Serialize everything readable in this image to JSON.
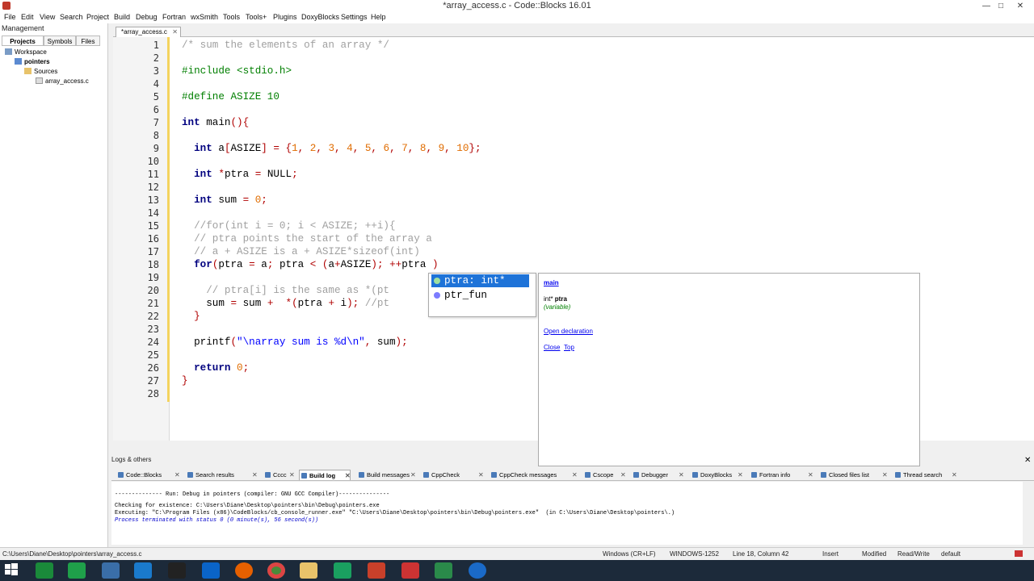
{
  "window": {
    "title": "*array_access.c - Code::Blocks 16.01",
    "minimize": "—",
    "maximize": "□",
    "close": "✕"
  },
  "menu": [
    "File",
    "Edit",
    "View",
    "Search",
    "Project",
    "Build",
    "Debug",
    "Fortran",
    "wxSmith",
    "Tools",
    "Tools+",
    "Plugins",
    "DoxyBlocks",
    "Settings",
    "Help"
  ],
  "management": {
    "title": "Management",
    "tabs": [
      "Projects",
      "Symbols",
      "Files"
    ],
    "tree": [
      "Workspace",
      "pointers",
      "Sources",
      "array_access.c"
    ]
  },
  "editor": {
    "tab_label": "*array_access.c",
    "line_numbers": [
      "1",
      "2",
      "3",
      "4",
      "5",
      "6",
      "7",
      "8",
      "9",
      "10",
      "11",
      "12",
      "13",
      "14",
      "15",
      "16",
      "17",
      "18",
      "19",
      "20",
      "21",
      "22",
      "23",
      "24",
      "25",
      "26",
      "27",
      "28"
    ]
  },
  "autocomplete": {
    "items": [
      "ptra: int*",
      "ptr_fun"
    ],
    "doc": {
      "scope": "main",
      "signature_type": "int*",
      "signature_name": "ptra",
      "kind": "(variable)",
      "open_declaration": "Open declaration",
      "close": "Close",
      "top": "Top"
    }
  },
  "logs": {
    "title": "Logs & others",
    "tabs": [
      "Code::Blocks",
      "Search results",
      "Cccc",
      "Build log",
      "Build messages",
      "CppCheck",
      "CppCheck messages",
      "Cscope",
      "Debugger",
      "DoxyBlocks",
      "Fortran info",
      "Closed files list",
      "Thread search"
    ],
    "active_tab": "Build log",
    "lines": [
      "-------------- Run: Debug in pointers (compiler: GNU GCC Compiler)---------------",
      "Checking for existence: C:\\Users\\Diane\\Desktop\\pointers\\bin\\Debug\\pointers.exe",
      "Executing: \"C:\\Program Files (x86)\\CodeBlocks/cb_console_runner.exe\" \"C:\\Users\\Diane\\Desktop\\pointers\\bin\\Debug\\pointers.exe\"  (in C:\\Users\\Diane\\Desktop\\pointers\\.)",
      "Process terminated with status 0 (0 minute(s), 56 second(s))"
    ]
  },
  "status": {
    "path": "C:\\Users\\Diane\\Desktop\\pointers\\array_access.c",
    "line_endings": "Windows (CR+LF)",
    "encoding": "WINDOWS-1252",
    "position": "Line 18, Column 42",
    "mode": "Insert",
    "modified": "Modified",
    "access": "Read/Write",
    "profile": "default"
  },
  "colors": {
    "accent": "#1e73d8",
    "taskbar": "#1c2a3a",
    "changebar": "#f4d35e"
  }
}
